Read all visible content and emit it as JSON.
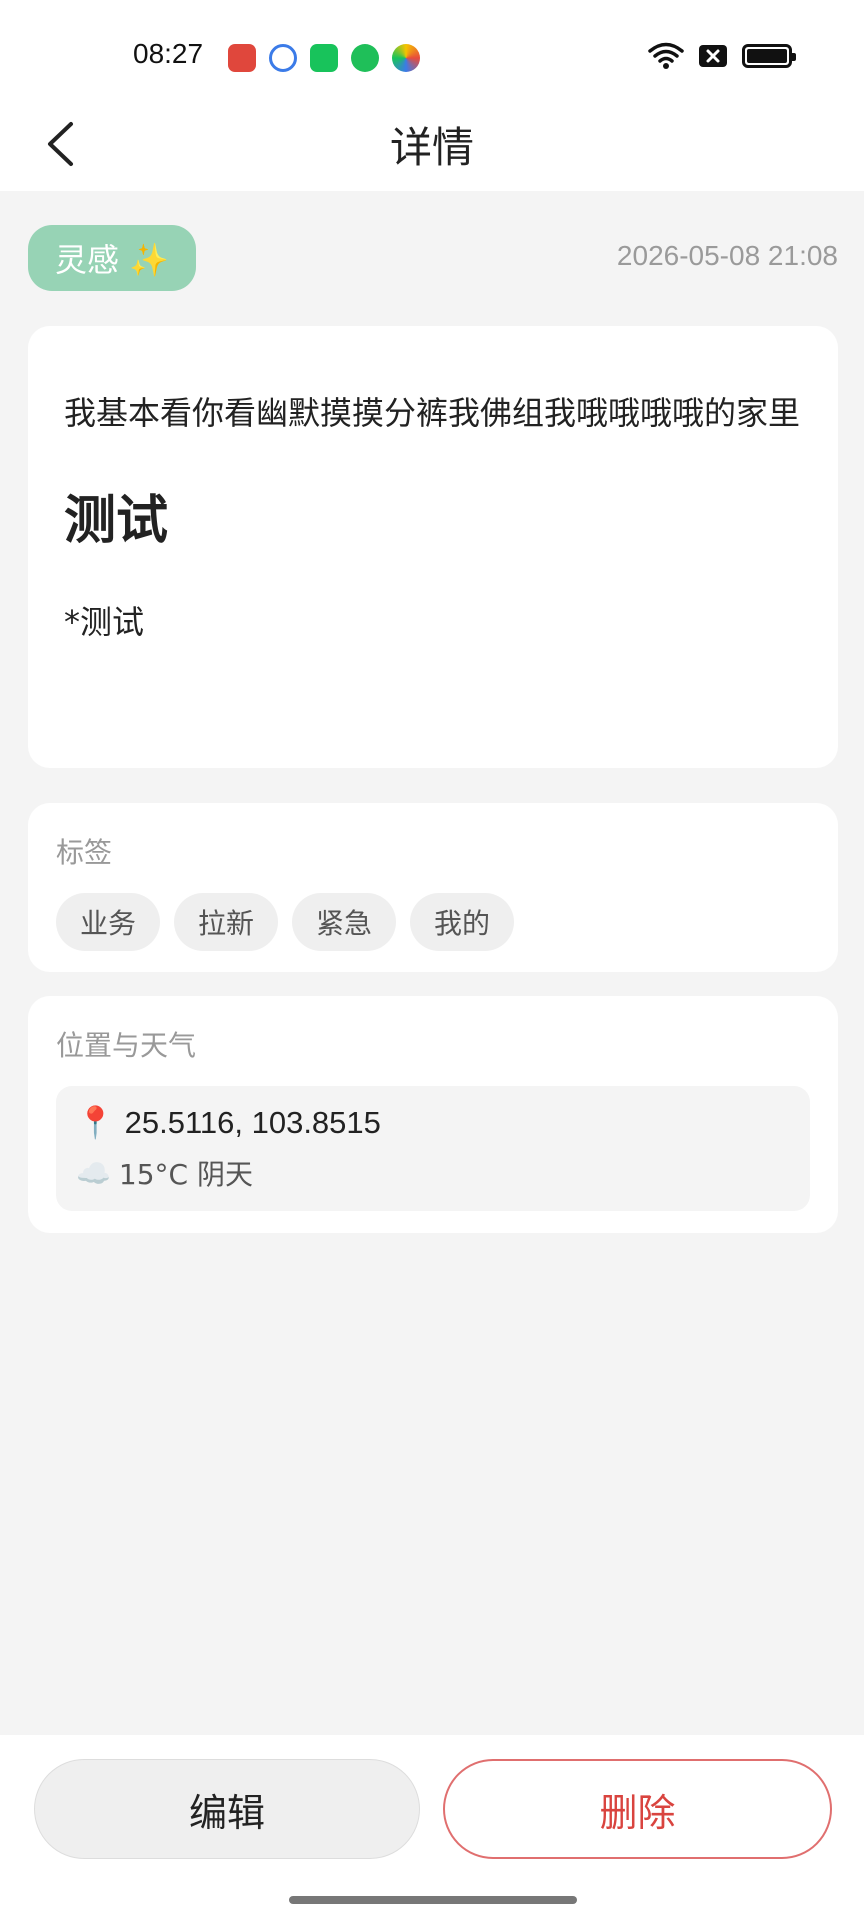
{
  "status_bar": {
    "time": "08:27",
    "app_icons": [
      "calendar-app-icon",
      "camera-app-icon",
      "wechat-app-icon",
      "upload-app-icon",
      "colorful-app-icon"
    ],
    "icons": [
      "wifi-icon",
      "no-sim-icon",
      "battery-icon"
    ]
  },
  "nav": {
    "title": "详情",
    "back_icon": "chevron-left-icon"
  },
  "note": {
    "category": "灵感 ✨",
    "category_color": "#97d3b5",
    "datetime": "2026-05-08 21:08",
    "paragraph": "我基本看你看幽默摸摸分裤我佛组我哦哦哦哦的家里",
    "heading": "测试",
    "note_line": "*测试"
  },
  "tags": {
    "label": "标签",
    "items": [
      "业务",
      "拉新",
      "紧急",
      "我的"
    ]
  },
  "location": {
    "label": "位置与天气",
    "pin_icon": "📍",
    "coords": "25.5116, 103.8515",
    "weather_icon": "☁️",
    "weather": "15°C 阴天"
  },
  "actions": {
    "edit_label": "编辑",
    "delete_label": "删除",
    "delete_color": "#d9443f"
  }
}
